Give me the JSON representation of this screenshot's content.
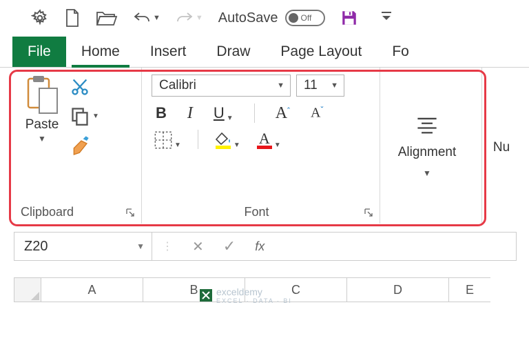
{
  "qat": {
    "autosave_label": "AutoSave",
    "autosave_state": "Off"
  },
  "tabs": {
    "file": "File",
    "home": "Home",
    "insert": "Insert",
    "draw": "Draw",
    "page_layout": "Page Layout",
    "formulas_partial": "Fo"
  },
  "ribbon": {
    "clipboard": {
      "paste": "Paste",
      "group_label": "Clipboard"
    },
    "font": {
      "name": "Calibri",
      "size": "11",
      "bold": "B",
      "italic": "I",
      "underline": "U",
      "grow": "A",
      "shrink": "A",
      "fill_letter": "",
      "color_letter": "A",
      "group_label": "Font"
    },
    "alignment": {
      "group_label": "Alignment"
    },
    "number_partial": "Nu"
  },
  "formula_bar": {
    "name_box": "Z20",
    "fx": "fx"
  },
  "columns": [
    "A",
    "B",
    "C",
    "D",
    "E"
  ],
  "watermark": {
    "brand": "exceldemy",
    "sub": "EXCEL · DATA · BI"
  },
  "colors": {
    "excel_green": "#107c41",
    "highlight_red": "#e63946",
    "fill_yellow": "#fff200",
    "font_red": "#e8151a",
    "save_purple": "#8f2aa8"
  }
}
